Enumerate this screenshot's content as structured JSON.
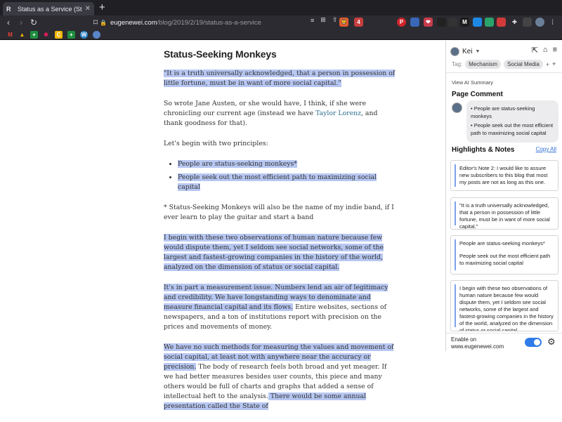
{
  "browser": {
    "tab_title": "Status as a Service (StaaS) — E",
    "tab_favicon": "R",
    "url_host": "eugenewei.com",
    "url_path": "/blog/2019/2/19/status-as-a-service",
    "brave_badge": "",
    "bat_count": "4"
  },
  "article": {
    "title": "Status-Seeking Monkeys",
    "p1": "\"It is a truth universally acknowledged, that a person in possession of little fortune, must be in want of more social capital.\"",
    "p2_a": "So wrote Jane Austen, or she would have, I think, if she were chronicling our current age (instead we have ",
    "p2_link": "Taylor Lorenz",
    "p2_b": ", and thank goodness for that).",
    "p3": "Let's begin with two principles:",
    "bullets": [
      "People are status-seeking monkeys*",
      "People seek out the most efficient path to maximizing social capital"
    ],
    "footnote": "* Status-Seeking Monkeys will also be the name of my indie band, if I ever learn to play the guitar and start a band",
    "p4": "I begin with these two observations of human nature because few would dispute them, yet I seldom see social networks, some of the largest and fastest-growing companies in the history of the world, analyzed on the dimension of status or social capital.",
    "p5_hl": "It's in part a measurement issue. Numbers lend an air of legitimacy and credibility. We have longstanding ways to denominate and measure financial capital and its flows.",
    "p5_rest": " Entire websites, sections of newspapers, and a ton of institutions report with precision on the prices and movements of money.",
    "p6_hl": "We have no such methods for measuring the values and movement of social capital, at least not with anywhere near the accuracy or precision.",
    "p6_rest": " The body of research feels both broad and yet meager. If we had better measures besides user counts, this piece and many others would be full of charts and graphs that added a sense of intellectual heft to the analysis.",
    "p6_tail": " There would be some annual presentation called the State of"
  },
  "sidebar": {
    "user": "Kei",
    "tag_label": "Tag:",
    "tags": [
      "Mechanism",
      "Social Media"
    ],
    "tag_add": "+",
    "ai_summary": "View AI Summary",
    "page_comment_title": "Page Comment",
    "comment_lines": [
      "• People are status-seeking monkeys",
      "• People seek out the most efficient path to maximizing social capital"
    ],
    "highlights_title": "Highlights & Notes",
    "copy_all": "Copy All",
    "notes": [
      [
        "Editor's Note 2: I would like to assure new subscribers to this blog that most my posts are not as long as this one."
      ],
      [
        "\"It is a truth universally acknowledged, that a person in possession of little fortune, must be in want of more social capital.\""
      ],
      [
        "People are status-seeking monkeys*",
        "People seek out the most efficient path to maximizing social capital"
      ],
      [
        "I begin with these two observations of human nature because few would dispute them, yet I seldom see social networks, some of the largest and fastest-growing companies in the history of the world, analyzed on the dimension of status or social capital."
      ]
    ],
    "enable_line1": "Enable on",
    "enable_line2": "www.eugenewei.com"
  },
  "colors": {
    "highlight": "#b7c7f2",
    "accent": "#2f7be8",
    "link": "#2b6e8f"
  }
}
